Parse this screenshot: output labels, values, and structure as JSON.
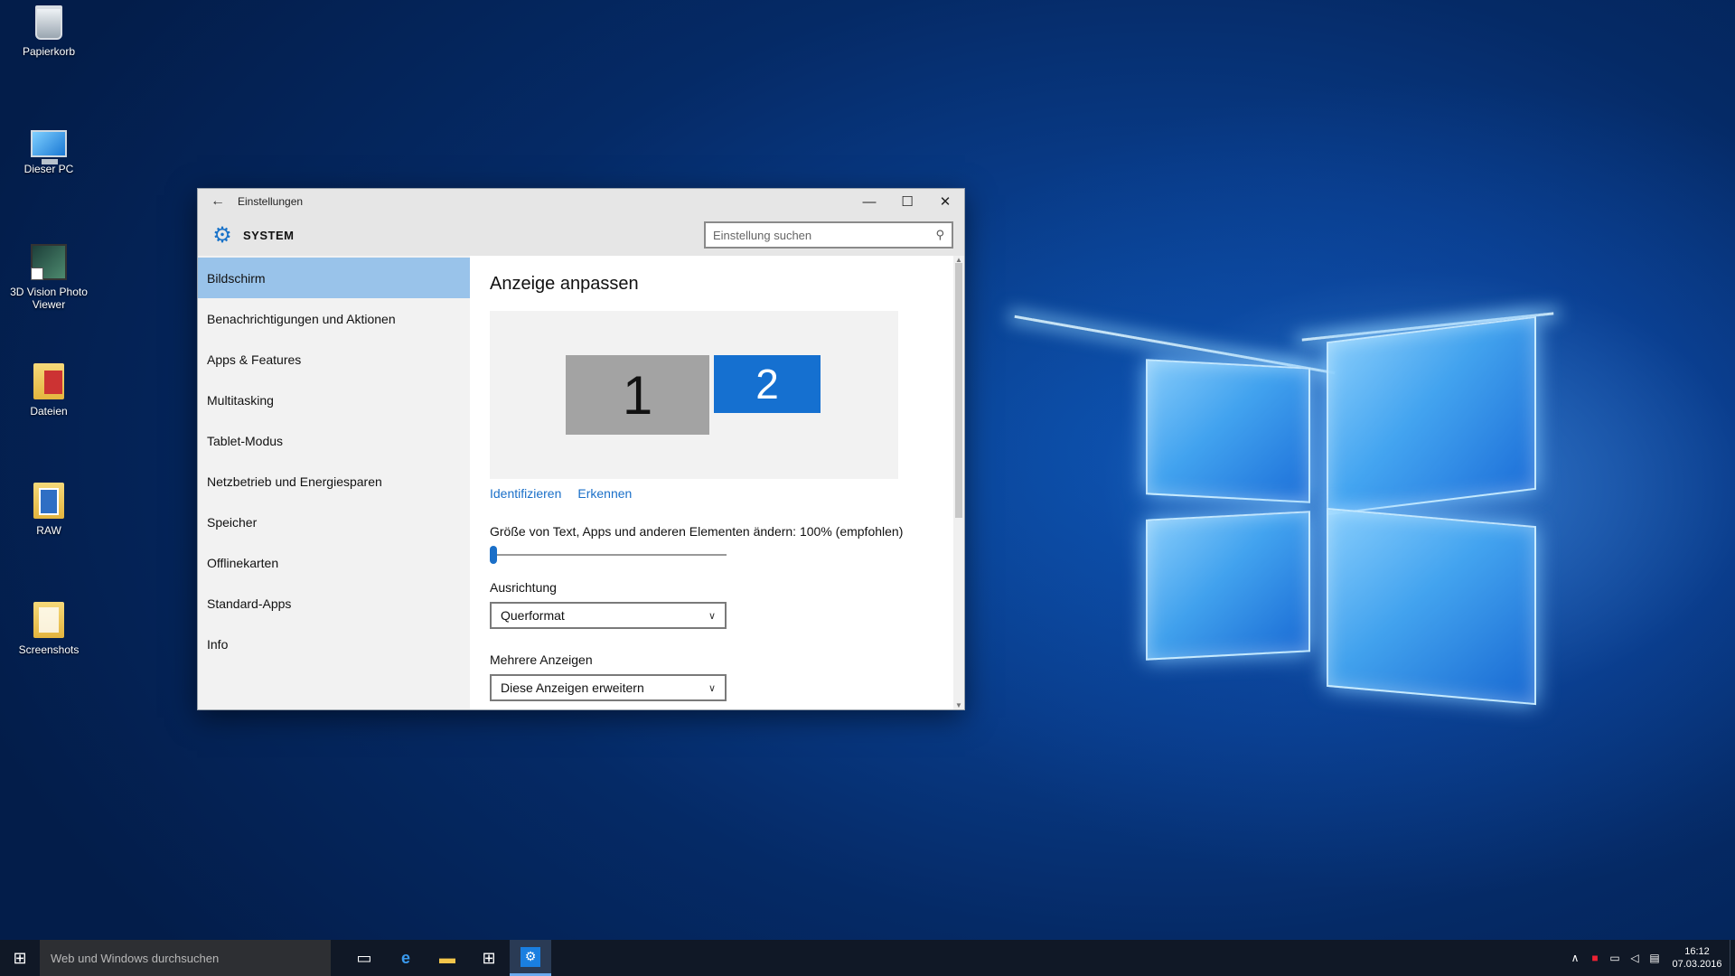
{
  "desktop": {
    "icons": [
      {
        "label": "Papierkorb",
        "icon": "recycle-bin-icon"
      },
      {
        "label": "Dieser PC",
        "icon": "computer-icon"
      },
      {
        "label": "3D Vision Photo Viewer",
        "icon": "photo-viewer-icon"
      },
      {
        "label": "Dateien",
        "icon": "folder-icon"
      },
      {
        "label": "RAW",
        "icon": "folder-icon"
      },
      {
        "label": "Screenshots",
        "icon": "folder-icon"
      }
    ]
  },
  "window": {
    "title": "Einstellungen",
    "back_glyph": "←",
    "minimize_glyph": "—",
    "maximize_glyph": "☐",
    "close_glyph": "✕",
    "section_title": "SYSTEM",
    "search_placeholder": "Einstellung suchen",
    "nav_items": [
      "Bildschirm",
      "Benachrichtigungen und Aktionen",
      "Apps & Features",
      "Multitasking",
      "Tablet-Modus",
      "Netzbetrieb und Energiesparen",
      "Speicher",
      "Offlinekarten",
      "Standard-Apps",
      "Info"
    ],
    "active_nav_index": 0
  },
  "content": {
    "title": "Anzeige anpassen",
    "monitor_1": "1",
    "monitor_2": "2",
    "link_identify": "Identifizieren",
    "link_detect": "Erkennen",
    "scale_label": "Größe von Text, Apps und anderen Elementen ändern: 100% (empfohlen)",
    "scale_slider_value_percent": 0,
    "orientation_label": "Ausrichtung",
    "orientation_value": "Querformat",
    "multiple_displays_label": "Mehrere Anzeigen",
    "multiple_displays_value": "Diese Anzeigen erweitern"
  },
  "taskbar": {
    "search_placeholder": "Web und Windows durchsuchen",
    "time": "16:12",
    "date": "07.03.2016"
  },
  "colors": {
    "accent": "#1a6fc8",
    "nav_active": "#99c3ea",
    "monitor_2": "#1570d0",
    "monitor_1": "#a3a3a3"
  }
}
